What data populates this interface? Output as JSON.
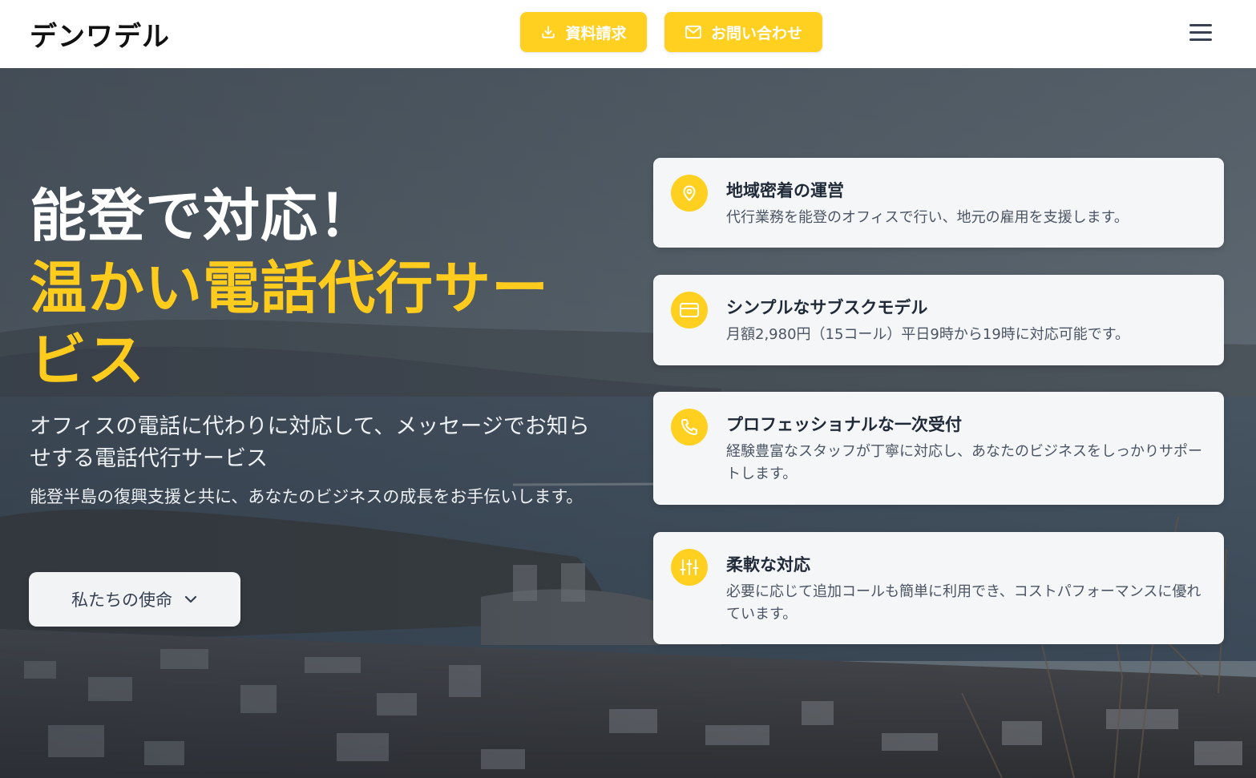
{
  "header": {
    "logo": "デンワデル",
    "doc_button": "資料請求",
    "contact_button": "お問い合わせ"
  },
  "hero": {
    "headline_white": "能登で対応！",
    "headline_yellow": "温かい電話代行サービス",
    "lead": "オフィスの電話に代わりに対応して、メッセージでお知らせする電話代行サービス",
    "sub": "能登半島の復興支援と共に、あなたのビジネスの成長をお手伝いします。",
    "mission_button": "私たちの使命"
  },
  "features": [
    {
      "icon": "location-pin-icon",
      "title": "地域密着の運営",
      "desc": "代行業務を能登のオフィスで行い、地元の雇用を支援します。"
    },
    {
      "icon": "credit-card-icon",
      "title": "シンプルなサブスクモデル",
      "desc": "月額2,980円（15コール）平日9時から19時に対応可能です。"
    },
    {
      "icon": "phone-icon",
      "title": "プロフェッショナルな一次受付",
      "desc": "経験豊富なスタッフが丁寧に対応し、あなたのビジネスをしっかりサポートします。"
    },
    {
      "icon": "sliders-icon",
      "title": "柔軟な対応",
      "desc": "必要に応じて追加コールも簡単に利用でき、コストパフォーマンスに優れています。"
    }
  ],
  "colors": {
    "accent": "#FFD01F",
    "headline_yellow": "#FFCC1E",
    "card_bg": "#F5F6F8"
  }
}
